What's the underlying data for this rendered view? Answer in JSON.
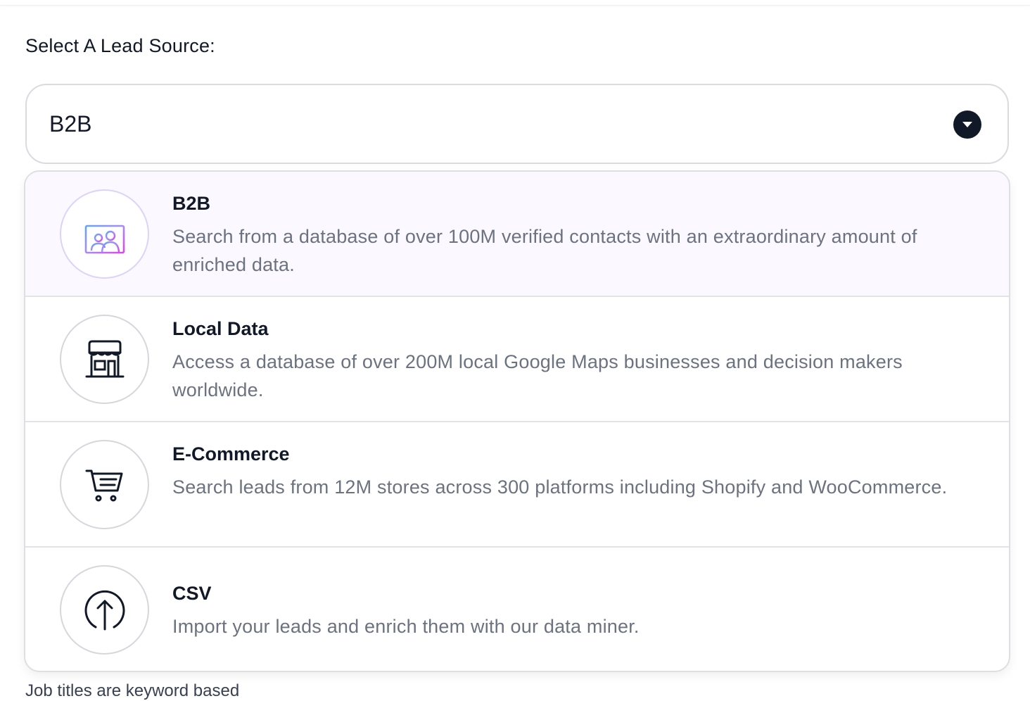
{
  "form": {
    "label": "Select A Lead Source:",
    "selected_value": "B2B",
    "helper_text": "Job titles are keyword based"
  },
  "options": [
    {
      "title": "B2B",
      "description": "Search from a database of over 100M verified contacts with an extraordinary amount of enriched data.",
      "icon": "contacts-card-icon",
      "selected": true
    },
    {
      "title": "Local Data",
      "description": "Access a database of over 200M local Google Maps businesses and decision makers worldwide.",
      "icon": "storefront-icon",
      "selected": false
    },
    {
      "title": "E-Commerce",
      "description": "Search leads from 12M stores across 300 platforms including Shopify and WooCommerce.",
      "icon": "shopping-cart-icon",
      "selected": false
    },
    {
      "title": "CSV",
      "description": "Import your leads and enrich them with our data miner.",
      "icon": "upload-icon",
      "selected": false
    }
  ],
  "colors": {
    "text_primary": "#111827",
    "text_secondary": "#6b7280",
    "selected_bg": "#fbf9ff",
    "gradient_start": "#60a5fa",
    "gradient_end": "#d946ef"
  }
}
